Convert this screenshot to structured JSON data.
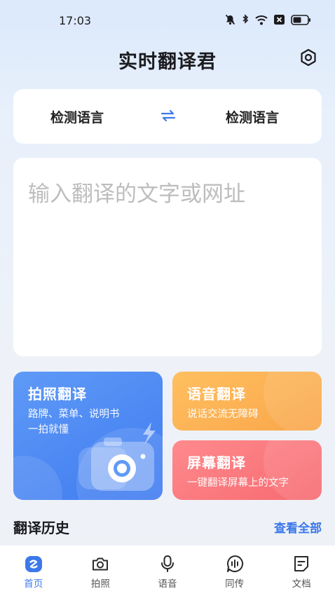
{
  "status_bar": {
    "time": "17:03",
    "icons": [
      "mute-bell-icon",
      "bluetooth-icon",
      "wifi-icon",
      "sim-x-icon",
      "battery-icon"
    ]
  },
  "header": {
    "title": "实时翻译君",
    "settings_icon": "settings-icon"
  },
  "language": {
    "source": "检测语言",
    "target": "检测语言",
    "swap_icon": "swap-arrows-icon"
  },
  "input": {
    "value": "",
    "placeholder": "输入翻译的文字或网址"
  },
  "features": [
    {
      "title": "拍照翻译",
      "desc_lines": [
        "路牌、菜单、说明书",
        "一拍就懂"
      ],
      "color": "#4a86f2"
    },
    {
      "title": "语音翻译",
      "desc_lines": [
        "说话交流无障碍"
      ],
      "color": "#fbb055"
    },
    {
      "title": "屏幕翻译",
      "desc_lines": [
        "一键翻译屏幕上的文字"
      ],
      "color": "#f8767b"
    }
  ],
  "history": {
    "title": "翻译历史",
    "view_all": "查看全部"
  },
  "tabs": [
    {
      "label": "首页",
      "icon": "home-icon",
      "active": true
    },
    {
      "label": "拍照",
      "icon": "camera-icon",
      "active": false
    },
    {
      "label": "语音",
      "icon": "microphone-icon",
      "active": false
    },
    {
      "label": "同传",
      "icon": "voice-bubble-icon",
      "active": false
    },
    {
      "label": "文档",
      "icon": "document-icon",
      "active": false
    }
  ],
  "colors": {
    "accent": "#3b78ea",
    "background": "#eef2f8"
  }
}
